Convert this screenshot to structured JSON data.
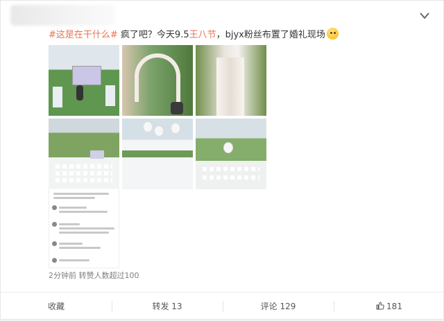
{
  "post": {
    "topic": "#这是在干什么#",
    "text_before_name": " 疯了吧？今天9.5",
    "name": "王八节",
    "text_after_name": "，bjyx粉丝布置了婚礼现场",
    "emoji": "confused-face-icon"
  },
  "photos": [
    {
      "name": "photo-lawn-screen"
    },
    {
      "name": "photo-flower-arch"
    },
    {
      "name": "photo-white-curtain-arch"
    },
    {
      "name": "photo-aerial-chairs"
    },
    {
      "name": "photo-balloons-chairs"
    },
    {
      "name": "photo-ceremony-seating"
    }
  ],
  "meta": {
    "time": "2分钟前",
    "reposts": "转赞人数超过100"
  },
  "footer": {
    "favorite": "收藏",
    "repost": "转发 13",
    "comment": "评论 129",
    "like": "181"
  },
  "colors": {
    "link": "#eb7350",
    "muted": "#808080"
  }
}
